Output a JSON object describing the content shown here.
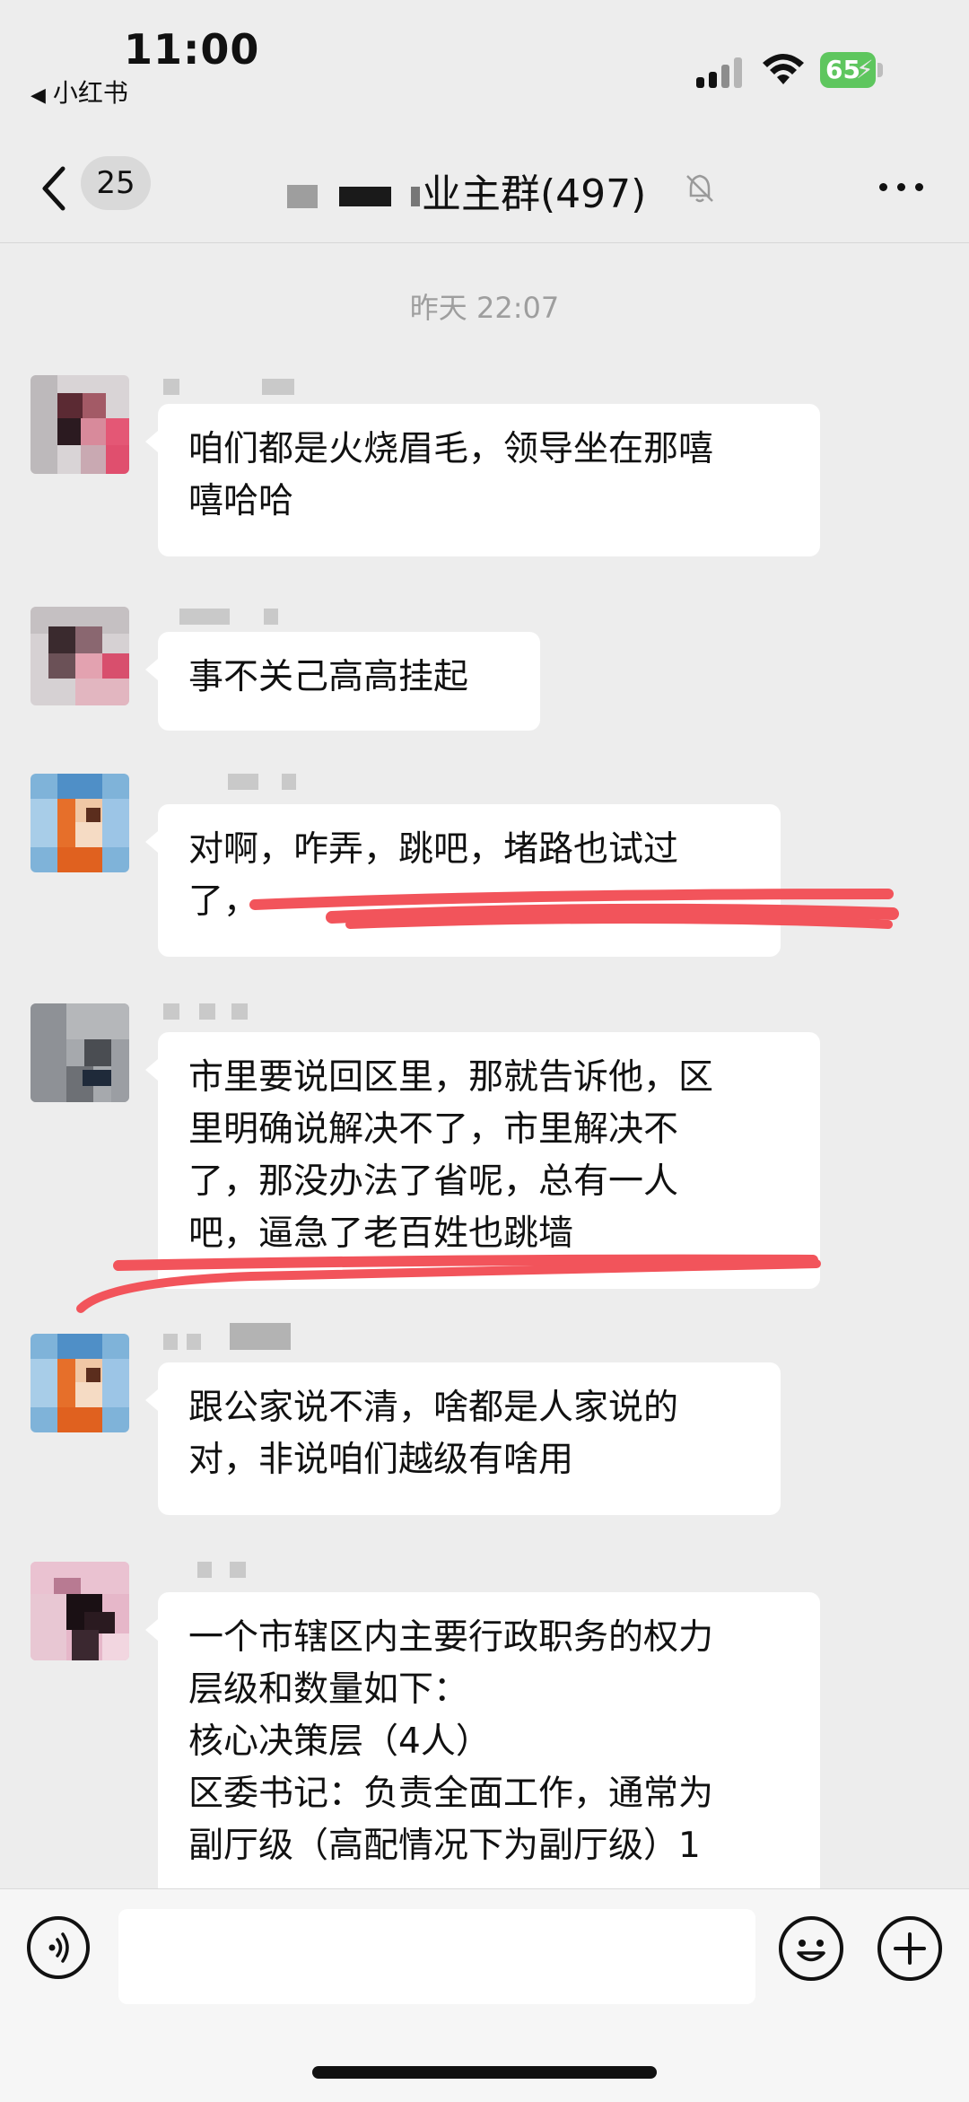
{
  "status_bar": {
    "time": "11:00",
    "back_app": "小红书",
    "battery": "65"
  },
  "header": {
    "unread_count": "25",
    "group_title": "业主群(497)"
  },
  "timestamp": "昨天 22:07",
  "messages": [
    {
      "text": "咱们都是火烧眉毛，领导坐在那嘻\n嘻哈哈"
    },
    {
      "text": "事不关己高高挂起"
    },
    {
      "text": "对啊，咋弄，跳吧，堵路也试过\n了，"
    },
    {
      "text": "市里要说回区里，那就告诉他，区\n里明确说解决不了，市里解决不\n了，那没办法了省呢，总有一人\n吧，逼急了老百姓也跳墙"
    },
    {
      "text": "跟公家说不清，啥都是人家说的\n对，非说咱们越级有啥用"
    },
    {
      "text": "一个市辖区内主要行政职务的权力\n层级和数量如下：\n核心决策层（4人）\n区委书记：负责全面工作，通常为\n副厅级（高配情况下为副厅级）1"
    }
  ],
  "colors": {
    "background": "#ededed",
    "bubble": "#ffffff",
    "annotation_red": "#f2545b",
    "battery_green": "#5ec65e"
  },
  "icons": {
    "back": "chevron-left-icon",
    "mute": "bell-off-icon",
    "more": "more-dots-icon",
    "voice": "voice-icon",
    "emoji": "emoji-icon",
    "plus": "plus-icon"
  }
}
